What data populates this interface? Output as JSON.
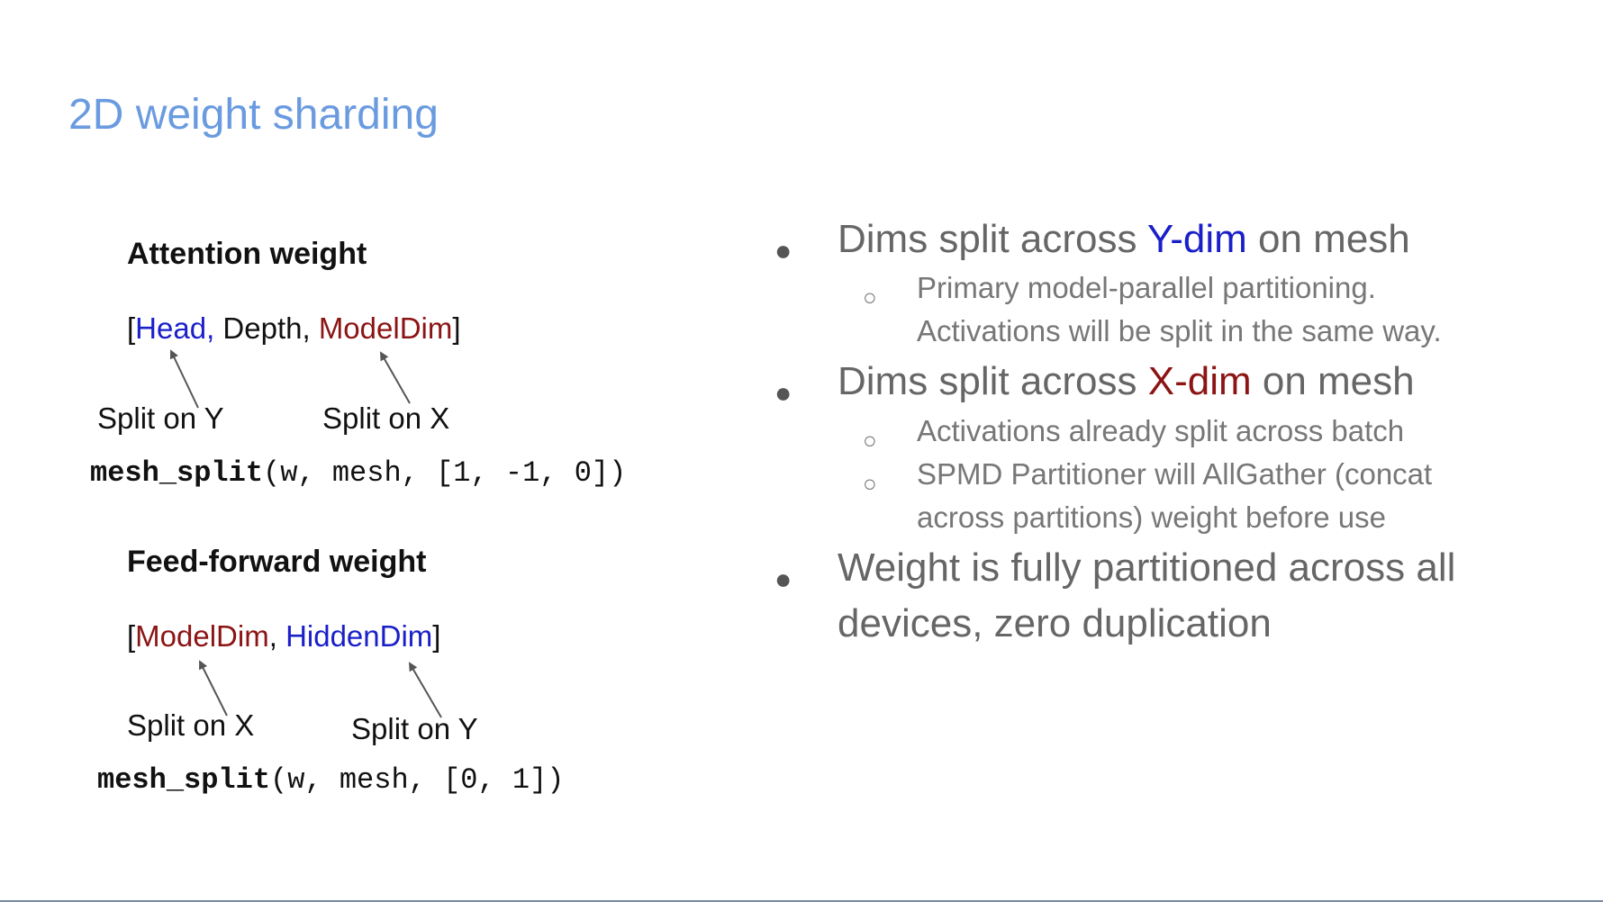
{
  "title": "2D weight sharding",
  "left": {
    "attention": {
      "heading": "Attention weight",
      "open_bracket": "[",
      "dim1": "Head,",
      "dim2": " Depth, ",
      "dim3": "ModelDim",
      "close_bracket": "]",
      "split_left": "Split on Y",
      "split_right": "Split on X",
      "code_fn": "mesh_split",
      "code_args": "(w, mesh, [1, -1, 0])"
    },
    "feedforward": {
      "heading": "Feed-forward weight",
      "open_bracket": "[",
      "dim1": "ModelDim",
      "sep": ", ",
      "dim2": "HiddenDim",
      "close_bracket": "]",
      "split_left": "Split on X",
      "split_right": "Split on Y",
      "code_fn": "mesh_split",
      "code_args": "(w, mesh, [0, 1])"
    }
  },
  "right": {
    "bullet1": {
      "pre": "Dims split across ",
      "highlight": "Y-dim",
      "post": " on mesh",
      "sub1": "Primary model-parallel partitioning. Activations will be split in the same way."
    },
    "bullet2": {
      "pre": "Dims split across ",
      "highlight": "X-dim",
      "post": " on mesh",
      "sub1": "Activations already split across batch",
      "sub2": "SPMD Partitioner will AllGather (concat across partitions) weight before use"
    },
    "bullet3": {
      "text": "Weight is fully partitioned across all devices, zero duplication"
    }
  },
  "colors": {
    "title": "#6a9be0",
    "y_dim": "#1a1fc8",
    "x_dim": "#8c1414"
  },
  "bullet_glyph": "●",
  "sub_bullet_glyph": "○"
}
